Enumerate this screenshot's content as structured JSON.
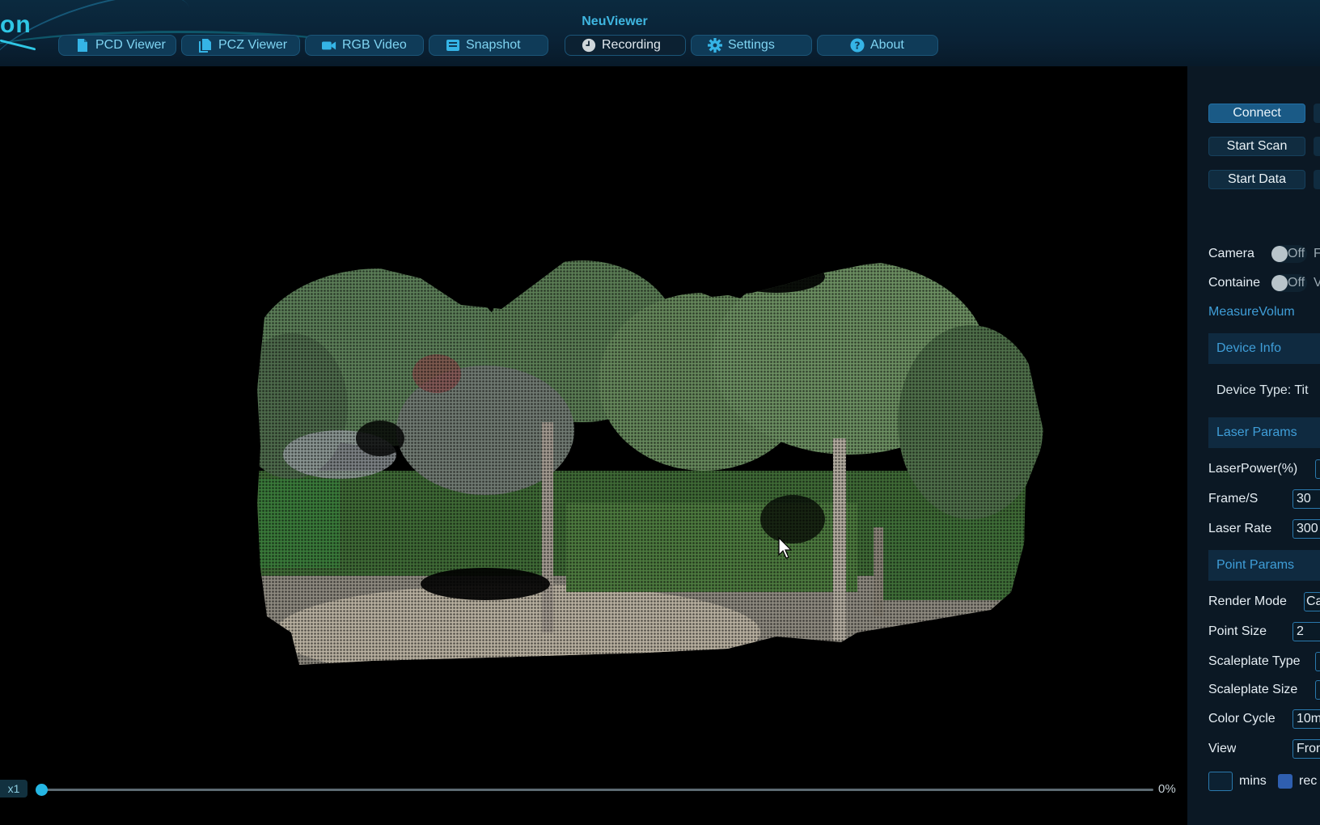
{
  "app": {
    "title": "NeuViewer",
    "logo_text": "on"
  },
  "tabs": [
    {
      "label": "PCD Viewer",
      "icon": "file-icon",
      "active": false
    },
    {
      "label": "PCZ Viewer",
      "icon": "files-icon",
      "active": false
    },
    {
      "label": "RGB Video",
      "icon": "video-camera-icon",
      "active": false
    },
    {
      "label": "Snapshot",
      "icon": "snapshot-icon",
      "active": false
    },
    {
      "label": "Recording",
      "icon": "clock-icon",
      "active": true
    },
    {
      "label": "Settings",
      "icon": "gear-icon",
      "active": false
    },
    {
      "label": "About",
      "icon": "help-circle-icon",
      "active": false
    }
  ],
  "viewer": {
    "speed_label": "x1",
    "progress_text": "0%",
    "progress": 0
  },
  "panel": {
    "buttons": {
      "connect": "Connect",
      "start_scan": "Start Scan",
      "start_data": "Start Data"
    },
    "camera": {
      "label": "Camera",
      "state": "Off",
      "tail": "F"
    },
    "container": {
      "label": "Containe",
      "state": "Off",
      "tail": "V"
    },
    "measure_volume": "MeasureVolum",
    "device_info": {
      "title": "Device Info",
      "device_type": "Device Type: Tit"
    },
    "laser_params": {
      "title": "Laser Params",
      "laser_power_label": "LaserPower(%)",
      "frame_label": "Frame/S",
      "frame_value": "30",
      "laser_rate_label": "Laser Rate",
      "laser_rate_value": "300"
    },
    "point_params": {
      "title": "Point Params",
      "render_mode_label": "Render Mode",
      "render_mode_value": "Ca",
      "point_size_label": "Point Size",
      "point_size_value": "2",
      "scaleplate_type_label": "Scaleplate Type",
      "scaleplate_size_label": "Scaleplate Size",
      "color_cycle_label": "Color Cycle",
      "color_cycle_value": "10m",
      "view_label": "View",
      "view_value": "Fron",
      "mins_label": "mins",
      "rec_label": "rec"
    }
  },
  "colors": {
    "accent": "#25b6e3",
    "tab_bg": "#0f3b58",
    "panel_bg": "#0b1824",
    "section_text": "#3f9ed8"
  }
}
